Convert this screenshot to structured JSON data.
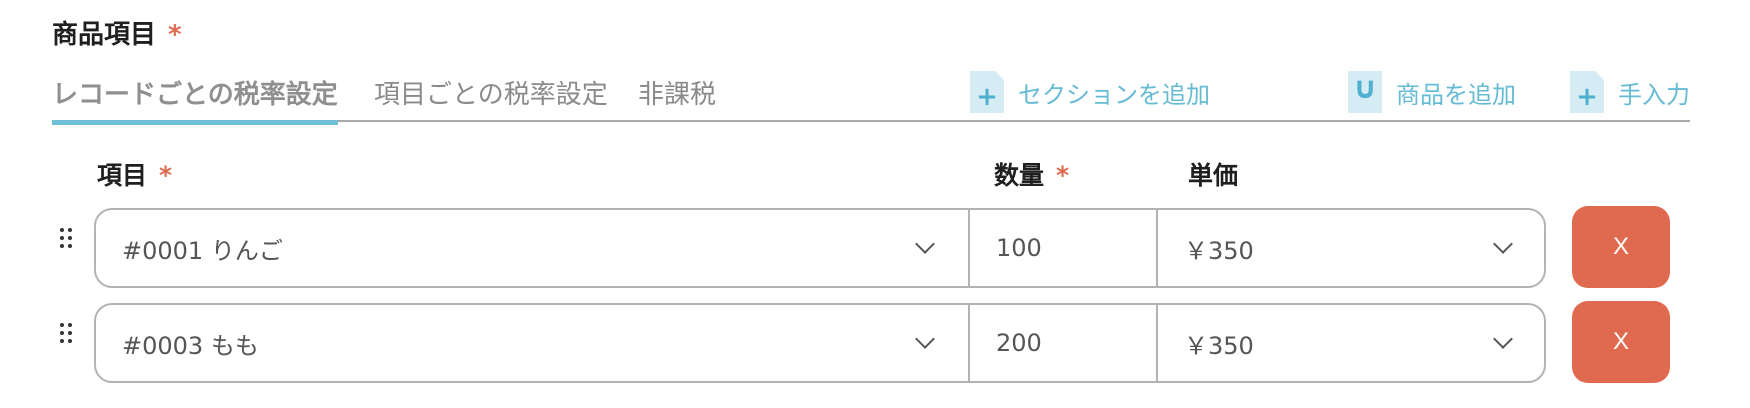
{
  "section": {
    "title": "商品項目",
    "required_mark": "*"
  },
  "tabs": [
    {
      "label": "レコードごとの税率設定",
      "active": true
    },
    {
      "label": "項目ごとの税率設定",
      "active": false
    },
    {
      "label": "非課税",
      "active": false
    }
  ],
  "actions": [
    {
      "label": "セクションを追加",
      "icon": "add-document-icon"
    },
    {
      "label": "商品を追加",
      "icon": "magnet-icon"
    },
    {
      "label": "手入力",
      "icon": "add-document-icon"
    }
  ],
  "columns": {
    "item": {
      "label": "項目",
      "required_mark": "*"
    },
    "quantity": {
      "label": "数量",
      "required_mark": "*"
    },
    "unit_price": {
      "label": "単価"
    }
  },
  "rows": [
    {
      "item": "#0001 りんご",
      "quantity": "100",
      "unit_price": "￥350",
      "delete_label": "X"
    },
    {
      "item": "#0003 もも",
      "quantity": "200",
      "unit_price": "￥350",
      "delete_label": "X"
    }
  ],
  "colors": {
    "accent": "#6fbfd6",
    "action_text": "#66bbd4",
    "danger": "#e06a4f",
    "required": "#e06a4f"
  }
}
